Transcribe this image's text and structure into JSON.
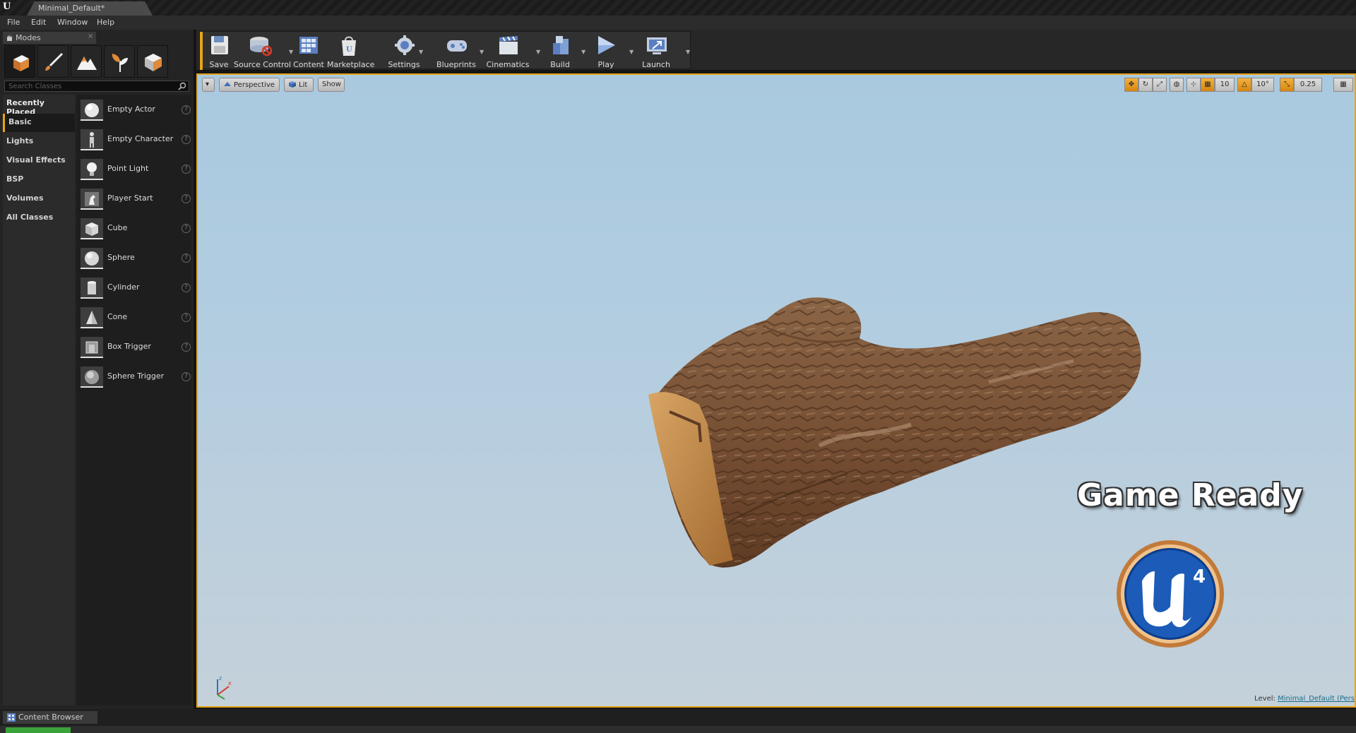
{
  "window": {
    "tab_title": "Minimal_Default*",
    "logo": "U"
  },
  "menu": [
    "File",
    "Edit",
    "Window",
    "Help"
  ],
  "modes_panel": {
    "tab_label": "Modes",
    "close": "×",
    "mode_icons": [
      "place-mode-icon",
      "paint-mode-icon",
      "landscape-mode-icon",
      "foliage-mode-icon",
      "geometry-mode-icon"
    ],
    "search_placeholder": "Search Classes",
    "categories": [
      "Recently Placed",
      "Basic",
      "Lights",
      "Visual Effects",
      "BSP",
      "Volumes",
      "All Classes"
    ],
    "active_category": "Basic",
    "items": [
      {
        "label": "Empty Actor",
        "icon": "sphere-icon"
      },
      {
        "label": "Empty Character",
        "icon": "character-icon"
      },
      {
        "label": "Point Light",
        "icon": "bulb-icon"
      },
      {
        "label": "Player Start",
        "icon": "player-start-icon"
      },
      {
        "label": "Cube",
        "icon": "cube-icon"
      },
      {
        "label": "Sphere",
        "icon": "sphere-icon"
      },
      {
        "label": "Cylinder",
        "icon": "cylinder-icon"
      },
      {
        "label": "Cone",
        "icon": "cone-icon"
      },
      {
        "label": "Box Trigger",
        "icon": "box-trigger-icon"
      },
      {
        "label": "Sphere Trigger",
        "icon": "sphere-trigger-icon"
      }
    ],
    "help_glyph": "?"
  },
  "toolbar": {
    "save": "Save",
    "source_control": "Source Control",
    "content": "Content",
    "marketplace": "Marketplace",
    "settings": "Settings",
    "blueprints": "Blueprints",
    "cinematics": "Cinematics",
    "build": "Build",
    "play": "Play",
    "launch": "Launch"
  },
  "viewport": {
    "menu_arrow": "▾",
    "perspective": "Perspective",
    "lit": "Lit",
    "show": "Show",
    "grid_snap": "10",
    "rotation_snap": "10°",
    "scale_snap": "0.25",
    "overlay_title": "Game Ready",
    "engine_badge": "4",
    "level_label": "Level:",
    "level_name": "Minimal_Default (Pers"
  },
  "bottom": {
    "content_browser_tab": "Content Browser"
  },
  "colors": {
    "accent": "#e8a317",
    "sky_top": "#a9c9df",
    "sky_bottom": "#c4d1da",
    "bark": "#7a5236"
  }
}
